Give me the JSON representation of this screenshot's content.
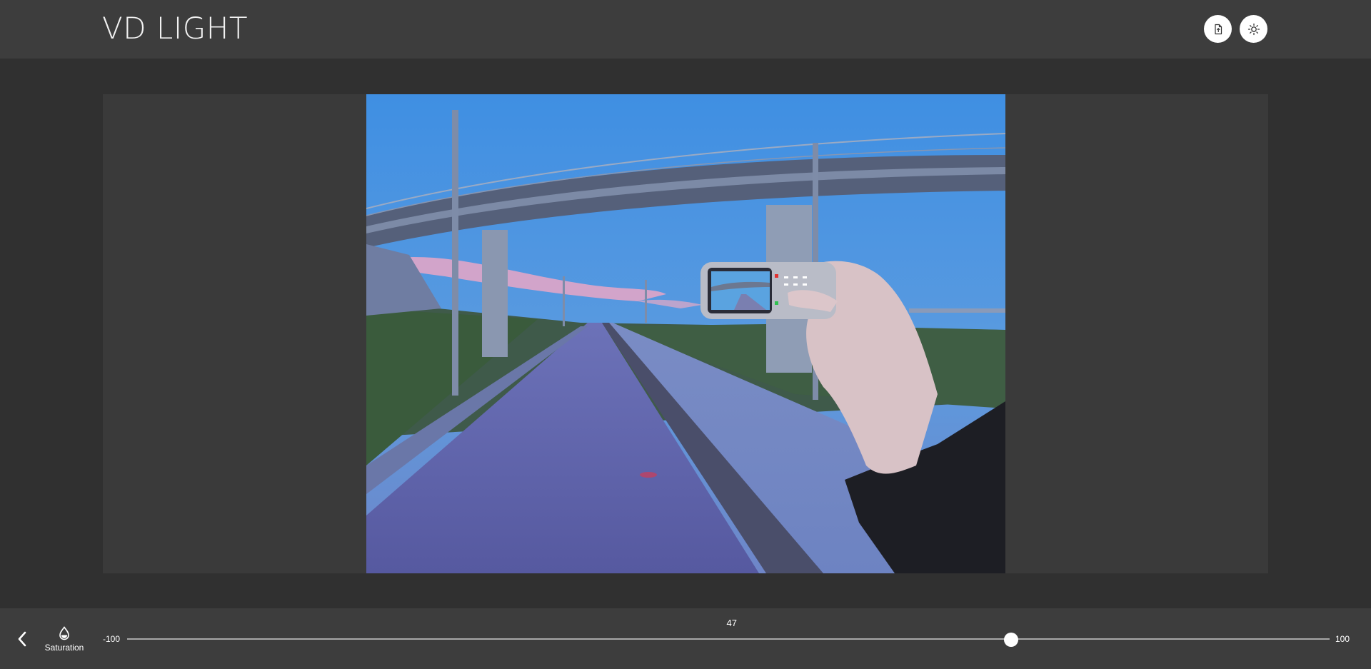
{
  "header": {
    "title": "VD LIGHT",
    "export_icon": "file-export-icon",
    "theme_icon": "sun-icon"
  },
  "photo": {
    "subject": "overpass-bridge-hand-holding-phone"
  },
  "toolbar": {
    "back_icon": "chevron-left-icon",
    "tool_icon": "droplet-icon",
    "tool_label": "Saturation"
  },
  "slider": {
    "min_label": "-100",
    "max_label": "100",
    "min": -100,
    "max": 100,
    "value": 47,
    "value_label": "47"
  },
  "colors": {
    "header_bg": "#3d3d3d",
    "page_bg": "#303030",
    "canvas_bg": "#3a3a3a",
    "button_bg": "#ffffff"
  }
}
